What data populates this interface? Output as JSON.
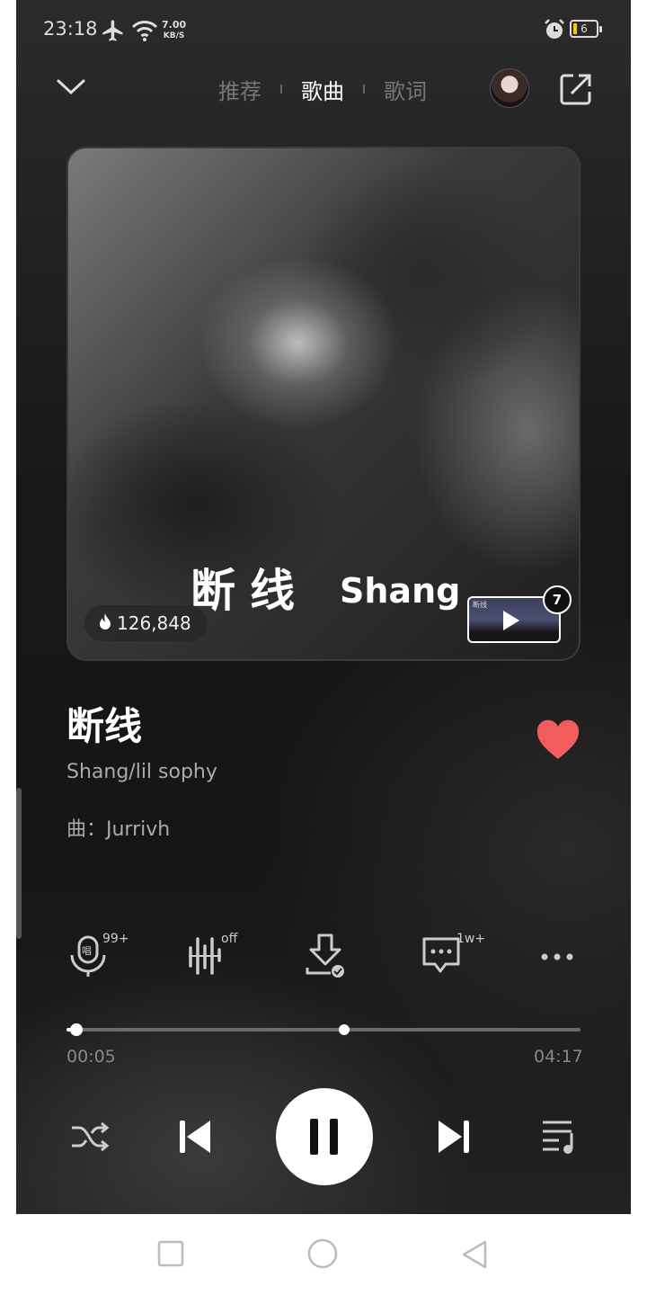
{
  "status_bar": {
    "time": "23:18",
    "net_speed_value": "7.00",
    "net_speed_unit": "KB/S",
    "battery": "6"
  },
  "top_bar": {
    "tabs": [
      {
        "label": "推荐",
        "active": false
      },
      {
        "label": "歌曲",
        "active": true
      },
      {
        "label": "歌词",
        "active": false
      }
    ]
  },
  "cover": {
    "title_text": "断线",
    "artist_text": "Shang",
    "heat_count": "126,848",
    "mv_label": "断线",
    "mv_badge": "7"
  },
  "song": {
    "title": "断线",
    "artists": "Shang/lil sophy",
    "composer": "曲：Jurrivh",
    "liked": true
  },
  "actions": {
    "sing_badge": "99+",
    "effect_badge": "off",
    "comment_badge": "1w+"
  },
  "progress": {
    "current": "00:05",
    "total": "04:17",
    "played_fraction": 0.02,
    "buffered_marker_fraction": 0.54
  },
  "colors": {
    "accent_heart": "#f25c5c",
    "background": "#1a1a1a"
  },
  "icons": {
    "collapse": "chevron-down-icon",
    "share": "share-icon",
    "sing": "microphone-icon",
    "effect": "sound-effect-icon",
    "download": "download-icon",
    "comment": "comment-icon",
    "more": "more-icon",
    "shuffle": "shuffle-icon",
    "prev": "previous-icon",
    "pause": "pause-icon",
    "next": "next-icon",
    "playlist": "playlist-icon"
  }
}
